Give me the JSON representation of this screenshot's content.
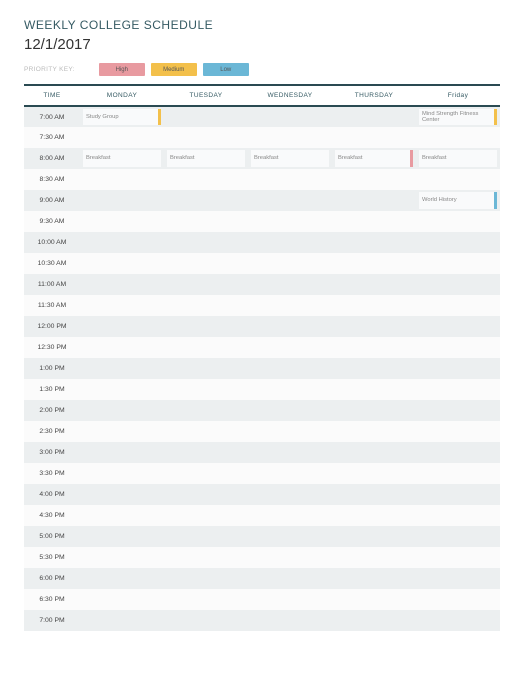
{
  "title": "WEEKLY COLLEGE SCHEDULE",
  "date": "12/1/2017",
  "legend": {
    "label": "PRIORITY KEY:",
    "high": "High",
    "medium": "Medium",
    "low": "Low"
  },
  "headers": {
    "time": "TIME",
    "mon": "MONDAY",
    "tue": "TUESDAY",
    "wed": "WEDNESDAY",
    "thu": "THURSDAY",
    "fri": "Friday"
  },
  "times": [
    "7:00 AM",
    "7:30 AM",
    "8:00 AM",
    "8:30 AM",
    "9:00 AM",
    "9:30 AM",
    "10:00 AM",
    "10:30 AM",
    "11:00 AM",
    "11:30 AM",
    "12:00 PM",
    "12:30 PM",
    "1:00 PM",
    "1:30 PM",
    "2:00 PM",
    "2:30 PM",
    "3:00 PM",
    "3:30 PM",
    "4:00 PM",
    "4:30 PM",
    "5:00 PM",
    "5:30 PM",
    "6:00 PM",
    "6:30 PM",
    "7:00 PM"
  ],
  "entries": {
    "mon_700": "Study Group",
    "mon_800": "Breakfast",
    "tue_800": "Breakfast",
    "wed_800": "Breakfast",
    "thu_800": "Breakfast",
    "fri_700": "Mind Strength Fitness Center",
    "fri_800": "Breakfast",
    "fri_900": "World History"
  },
  "colors": {
    "high": "#e89aa0",
    "medium": "#f3c04b",
    "low": "#6bb7d6"
  }
}
